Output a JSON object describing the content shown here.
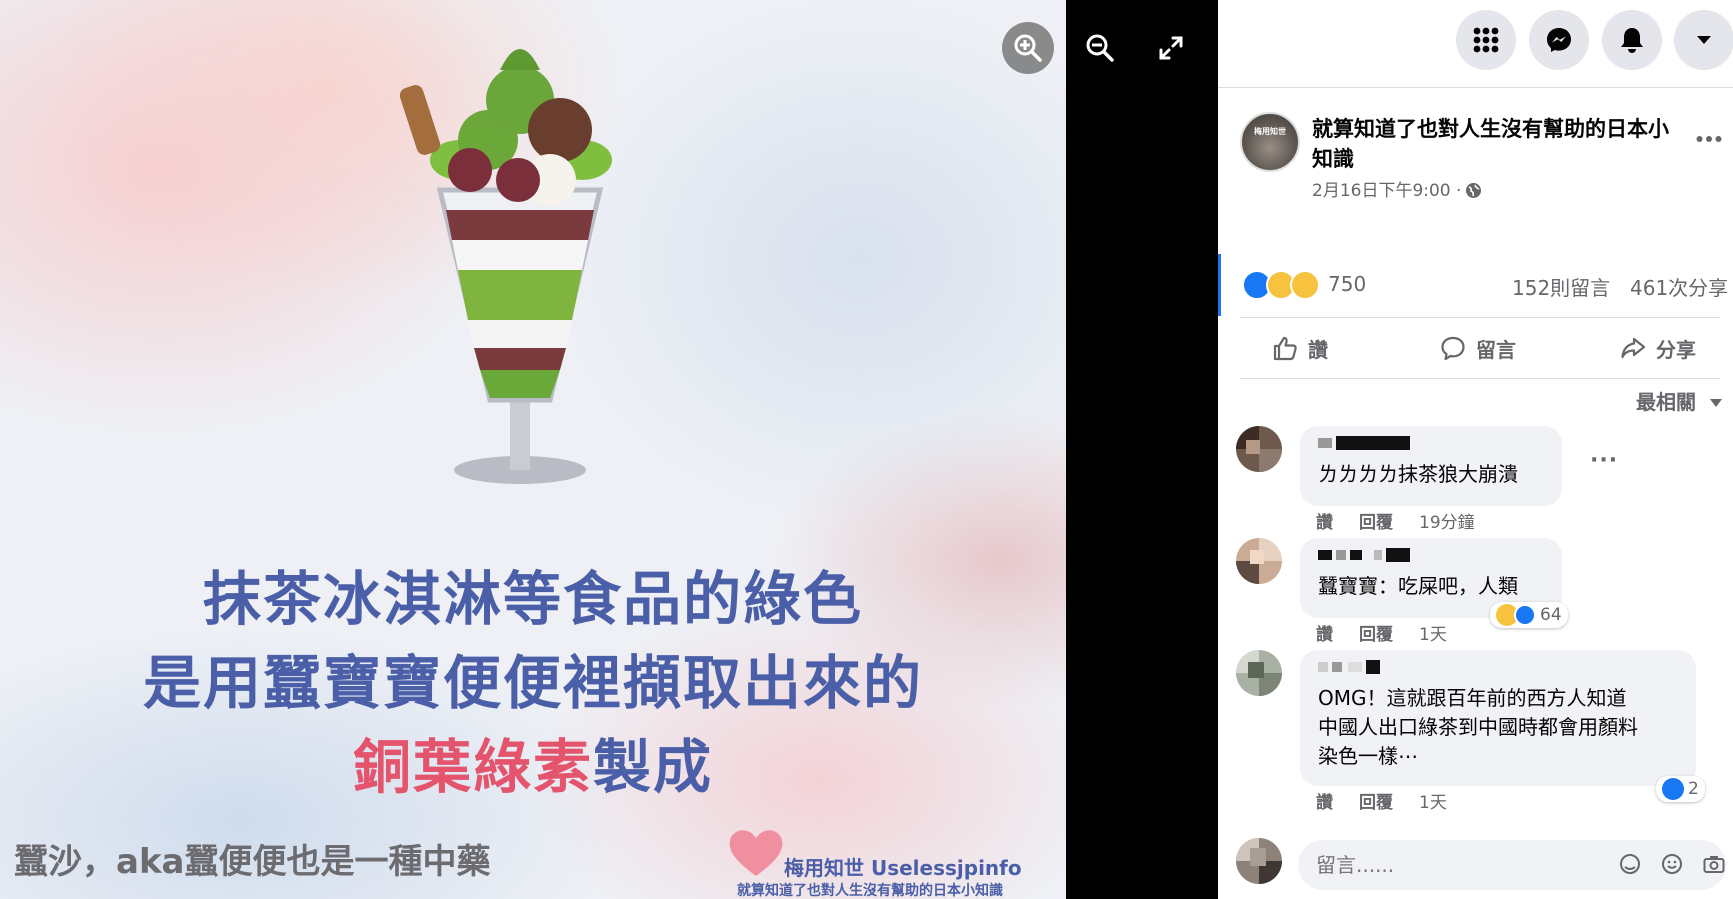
{
  "photo": {
    "line1": "抹茶冰淇淋等食品的綠色",
    "line2": "是用蠶寶寶便便裡擷取出來的",
    "line3_highlight": "銅葉綠素",
    "line3_rest": "製成",
    "caption": "蠶沙，aka蠶便便也是一種中藥",
    "brand_name": "梅用知世 Uselessjpinfo",
    "brand_tagline": "就算知道了也對人生沒有幫助的日本小知識"
  },
  "viewer_controls": {
    "zoom_in_icon": "zoom-in-icon",
    "zoom_out_icon": "zoom-out-icon",
    "fullscreen_icon": "expand-icon"
  },
  "post": {
    "page_name": "就算知道了也對人生沒有幫助的日本小知識",
    "avatar_label": "梅用知世",
    "timestamp": "2月16日下午9:00 ·",
    "more": "…",
    "reaction_count": "750",
    "comment_count": "152則留言",
    "share_count": "461次分享",
    "like_label": "讚",
    "comment_label": "留言",
    "share_label": "分享",
    "sort_label": "最相關"
  },
  "comments": [
    {
      "text": "ㄌㄌㄌㄌ抹茶狼大崩潰",
      "like": "讚",
      "reply": "回覆",
      "time": "19分鐘",
      "more": "···"
    },
    {
      "text": "蠶寶寶：吃屎吧，人類",
      "like": "讚",
      "reply": "回覆",
      "time": "1天",
      "reactions": "64"
    },
    {
      "text": "OMG！這就跟百年前的西方人知道\n中國人出口綠茶到中國時都會用顏料\n染色一樣⋯",
      "like": "讚",
      "reply": "回覆",
      "time": "1天",
      "reactions": "2"
    }
  ],
  "composer": {
    "placeholder": "留言......"
  },
  "colors": {
    "brand_blue": "#1877f2",
    "title_blue": "#4a5fa8",
    "highlight_pink": "#e4546c"
  }
}
